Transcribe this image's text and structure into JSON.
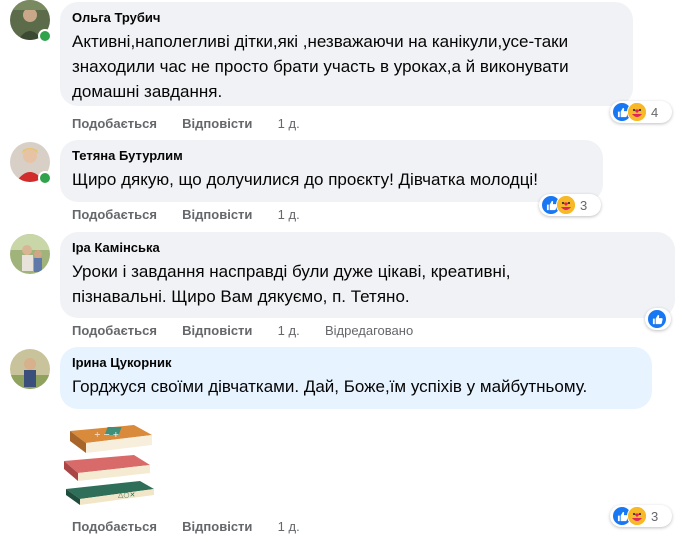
{
  "colors": {
    "accent": "#1877f2",
    "bubble": "#f0f2f5",
    "highlight": "#e7f3ff",
    "online": "#31a24c",
    "meta": "#65676b"
  },
  "comments": [
    {
      "author": "Ольга Трубич",
      "lines": [
        "Активні,наполегливі дітки,які ,незважаючи на канікули,усе-таки",
        "знаходили час не просто брати участь в уроках,а й виконувати",
        "домашні завдання."
      ],
      "like": "Подобається",
      "reply": "Відповісти",
      "time": "1 д.",
      "reactions": [
        "like-icon",
        "care-icon"
      ],
      "reaction_count": "4"
    },
    {
      "author": "Тетяна Бутурлим",
      "lines": [
        "Щиро дякую, що долучилися до проєкту! Дівчатка молодці!"
      ],
      "like": "Подобається",
      "reply": "Відповісти",
      "time": "1 д.",
      "reactions": [
        "like-icon",
        "care-icon"
      ],
      "reaction_count": "3"
    },
    {
      "author": "Іра Камінська",
      "lines": [
        "Уроки і завдання насправді були дуже цікаві, креативні,",
        "пізнавальні. Щиро Вам дякуємо, п. Тетяно."
      ],
      "like": "Подобається",
      "reply": "Відповісти",
      "time": "1 д.",
      "edited": "Відредаговано",
      "reactions": [
        "like-icon"
      ]
    },
    {
      "author": "Ірина Цукорник",
      "lines": [
        "Горджуся своїми дівчатками. Дай, Боже,їм успіхів у майбутньому."
      ],
      "sticker": "books-sticker",
      "like": "Подобається",
      "reply": "Відповісти",
      "time": "1 д.",
      "reactions": [
        "like-icon",
        "care-icon"
      ],
      "reaction_count": "3"
    }
  ]
}
